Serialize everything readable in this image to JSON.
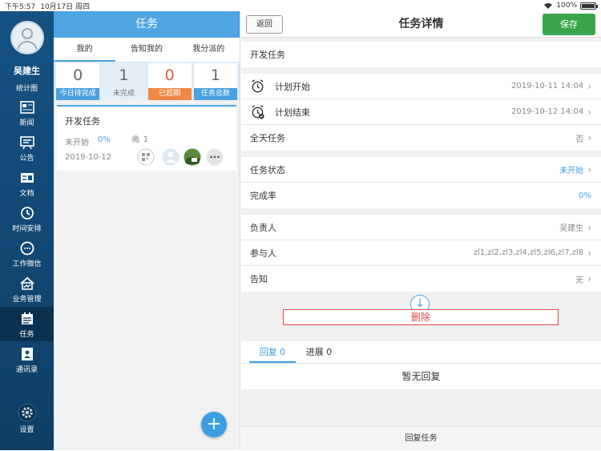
{
  "statusbar": {
    "time": "下午5:57",
    "date": "10月17日 周四",
    "battery": "100%"
  },
  "leftnav": {
    "username": "吴建生",
    "stats_link": "统计图",
    "items": [
      {
        "label": "新闻",
        "icon": "news-icon"
      },
      {
        "label": "公告",
        "icon": "announcement-icon"
      },
      {
        "label": "文档",
        "icon": "document-icon"
      },
      {
        "label": "时间安排",
        "icon": "history-clock-icon"
      },
      {
        "label": "工作微信",
        "icon": "chat-icon"
      },
      {
        "label": "业务管理",
        "icon": "business-icon"
      },
      {
        "label": "任务",
        "icon": "task-icon",
        "active": true
      },
      {
        "label": "通讯录",
        "icon": "contacts-icon"
      },
      {
        "label": "设置",
        "icon": "gear-icon"
      }
    ]
  },
  "midpane": {
    "title": "任务",
    "tabs": [
      "我的",
      "告知我的",
      "我分派的"
    ],
    "stats": [
      {
        "value": "0",
        "label": "今日待完成"
      },
      {
        "value": "1",
        "label": "未完成"
      },
      {
        "value": "0",
        "label": "已超期"
      },
      {
        "value": "1",
        "label": "任务总数"
      }
    ],
    "task": {
      "title": "开发任务",
      "status": "未开始",
      "percent": "0%",
      "attachments": "1",
      "date": "2019-10-12"
    },
    "fab_label": "+"
  },
  "detail": {
    "back_label": "返回",
    "title": "任务详情",
    "save_label": "保存",
    "task_name": "开发任务",
    "plan_start_label": "计划开始",
    "plan_start_value": "2019-10-11 14:04",
    "plan_end_label": "计划结束",
    "plan_end_value": "2019-10-12 14:04",
    "all_day_label": "全天任务",
    "all_day_value": "否",
    "status_label": "任务状态",
    "status_value": "未开始",
    "completion_label": "完成率",
    "completion_value": "0%",
    "owner_label": "负责人",
    "owner_value": "吴建生",
    "participants_label": "参与人",
    "participants_value": "zl1,zl2,zl3,zl4,zl5,zl6,zl7,zl8",
    "notify_label": "告知",
    "notify_value": "无",
    "delete_label": "删除",
    "reply_tab": "回复 0",
    "progress_tab": "进展 0",
    "no_reply": "暂无回复",
    "bottom_label": "回复任务"
  },
  "colors": {
    "nav_bg": "#155283",
    "accent": "#4fa4e2",
    "save": "#3aa44b",
    "danger": "#e24a4a",
    "overdue": "#f08747"
  }
}
